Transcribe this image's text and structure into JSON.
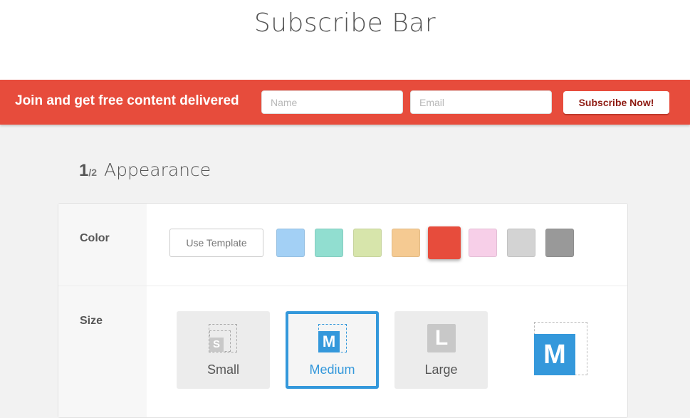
{
  "page": {
    "title": "Subscribe Bar"
  },
  "subscribe_bar": {
    "text": "Join and get free content delivered",
    "name_placeholder": "Name",
    "email_placeholder": "Email",
    "button_label": "Subscribe Now!",
    "bar_color": "#e74c3c"
  },
  "step": {
    "number": "1",
    "of": "/2",
    "label": "Appearance"
  },
  "color_row": {
    "label": "Color",
    "template_button": "Use Template",
    "swatches": [
      {
        "color": "#a3d0f5",
        "selected": false
      },
      {
        "color": "#91ded0",
        "selected": false
      },
      {
        "color": "#d7e5ab",
        "selected": false
      },
      {
        "color": "#f5ca92",
        "selected": false
      },
      {
        "color": "#e74c3c",
        "selected": true
      },
      {
        "color": "#f7cfe8",
        "selected": false
      },
      {
        "color": "#d3d3d3",
        "selected": false
      },
      {
        "color": "#999999",
        "selected": false
      }
    ]
  },
  "size_row": {
    "label": "Size",
    "options": [
      {
        "label": "Small",
        "letter": "S",
        "selected": false
      },
      {
        "label": "Medium",
        "letter": "M",
        "selected": true
      },
      {
        "label": "Large",
        "letter": "L",
        "selected": false
      }
    ],
    "preview_letter": "M",
    "accent": "#3498db"
  }
}
